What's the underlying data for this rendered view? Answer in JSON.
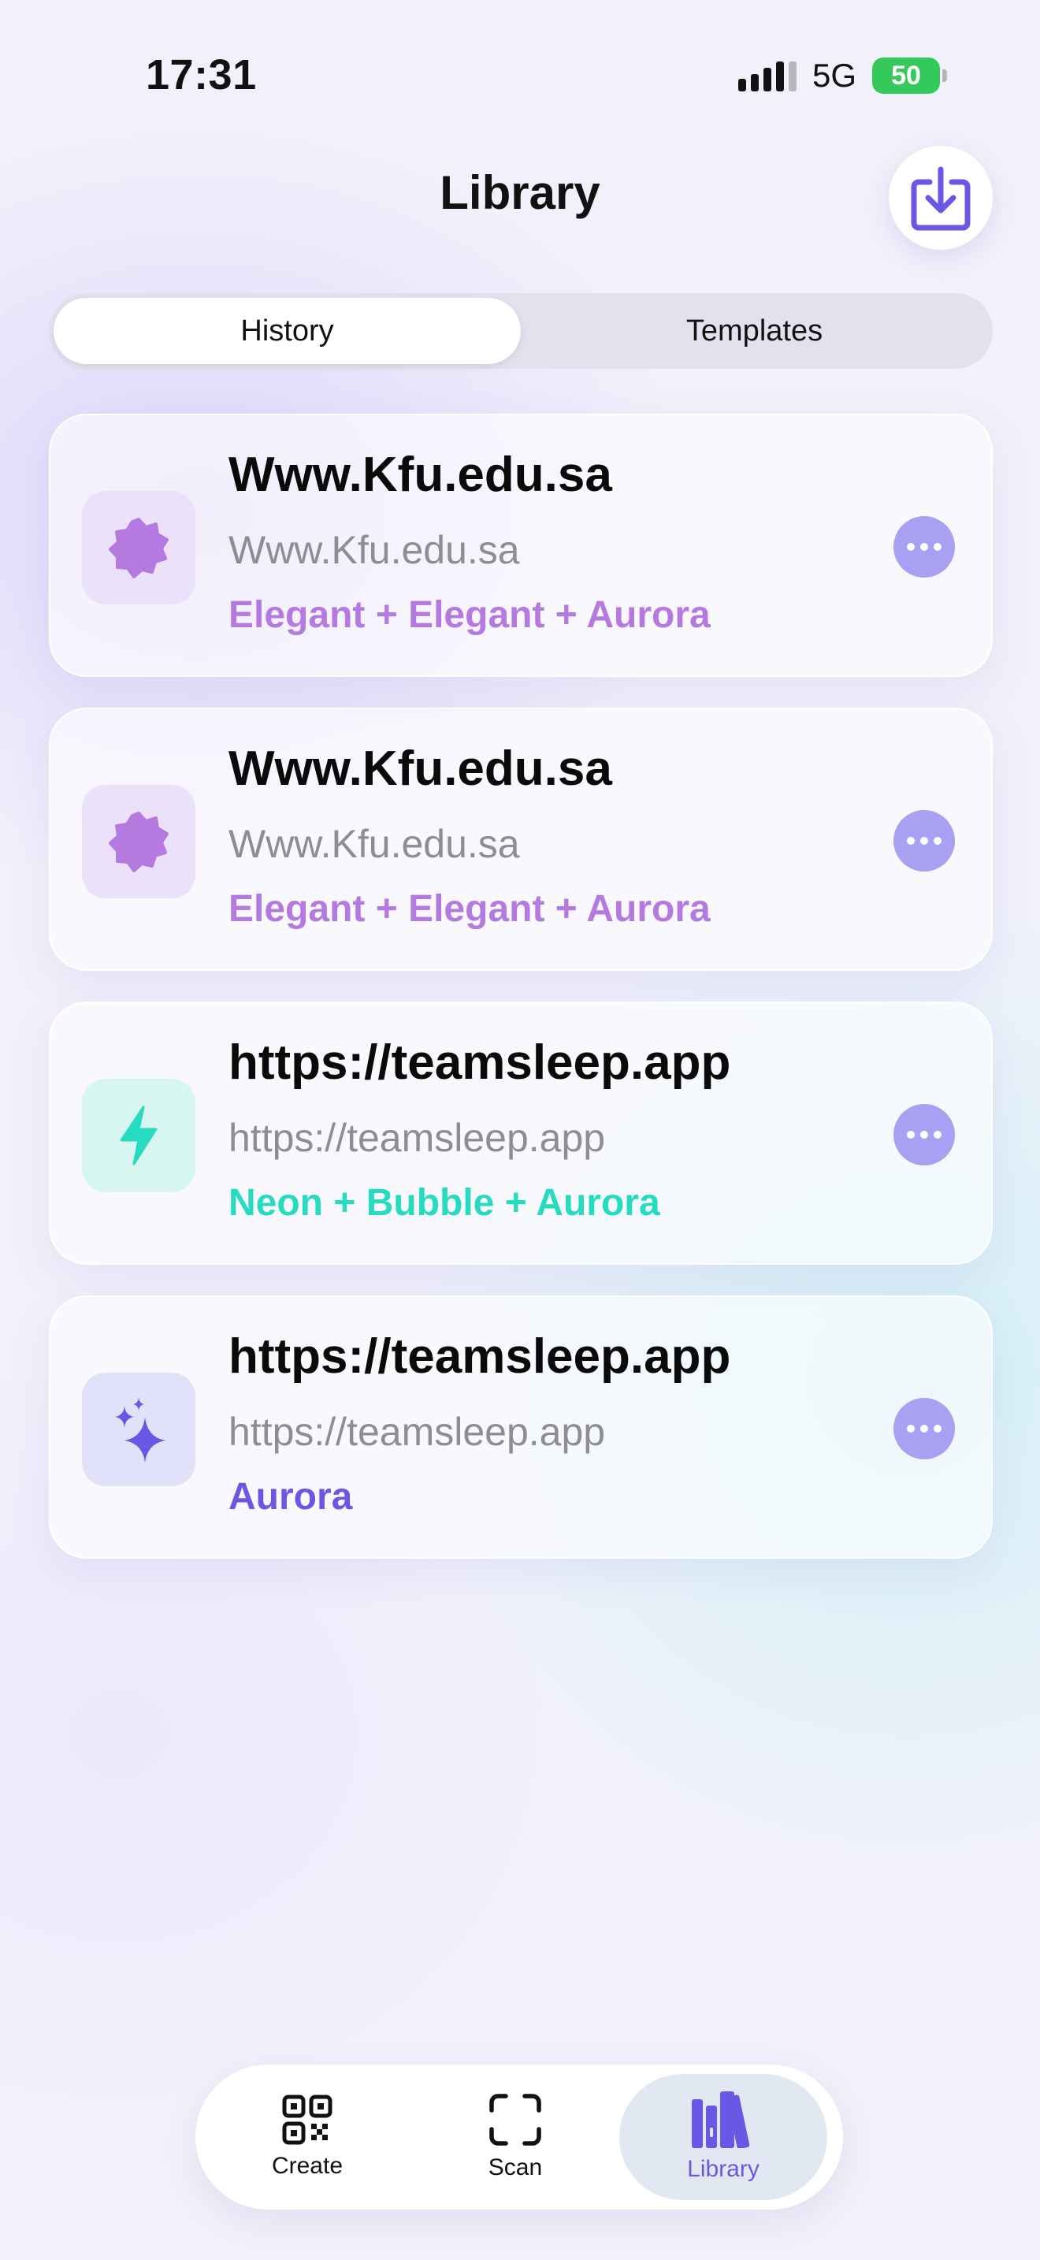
{
  "status_bar": {
    "time": "17:31",
    "network": "5G",
    "battery": "50"
  },
  "header": {
    "title": "Library",
    "import_icon": "download-tray-icon"
  },
  "segmented": {
    "tabs": [
      "History",
      "Templates"
    ],
    "selected": "History"
  },
  "colors": {
    "accent": "#6a58e4",
    "elegant": "#b47ae0",
    "neon": "#26dbc0",
    "aurora": "#6a58e4",
    "more": "#a9a0f3"
  },
  "history": [
    {
      "title": "Www.Kfu.edu.sa",
      "subtitle": "Www.Kfu.edu.sa",
      "style": "Elegant + Elegant + Aurora",
      "icon": "badge-icon",
      "style_color": "#b47ae0"
    },
    {
      "title": "Www.Kfu.edu.sa",
      "subtitle": "Www.Kfu.edu.sa",
      "style": "Elegant + Elegant + Aurora",
      "icon": "badge-icon",
      "style_color": "#b47ae0"
    },
    {
      "title": "https://teamsleep.app",
      "subtitle": "https://teamsleep.app",
      "style": "Neon + Bubble + Aurora",
      "icon": "bolt-icon",
      "style_color": "#26dbc0"
    },
    {
      "title": "https://teamsleep.app",
      "subtitle": "https://teamsleep.app",
      "style": "Aurora",
      "icon": "sparkles-icon",
      "style_color": "#6a58e4"
    }
  ],
  "tab_bar": {
    "items": [
      {
        "label": "Create",
        "icon": "qr-code-icon"
      },
      {
        "label": "Scan",
        "icon": "scan-frame-icon"
      },
      {
        "label": "Library",
        "icon": "books-icon"
      }
    ],
    "selected": "Library"
  }
}
